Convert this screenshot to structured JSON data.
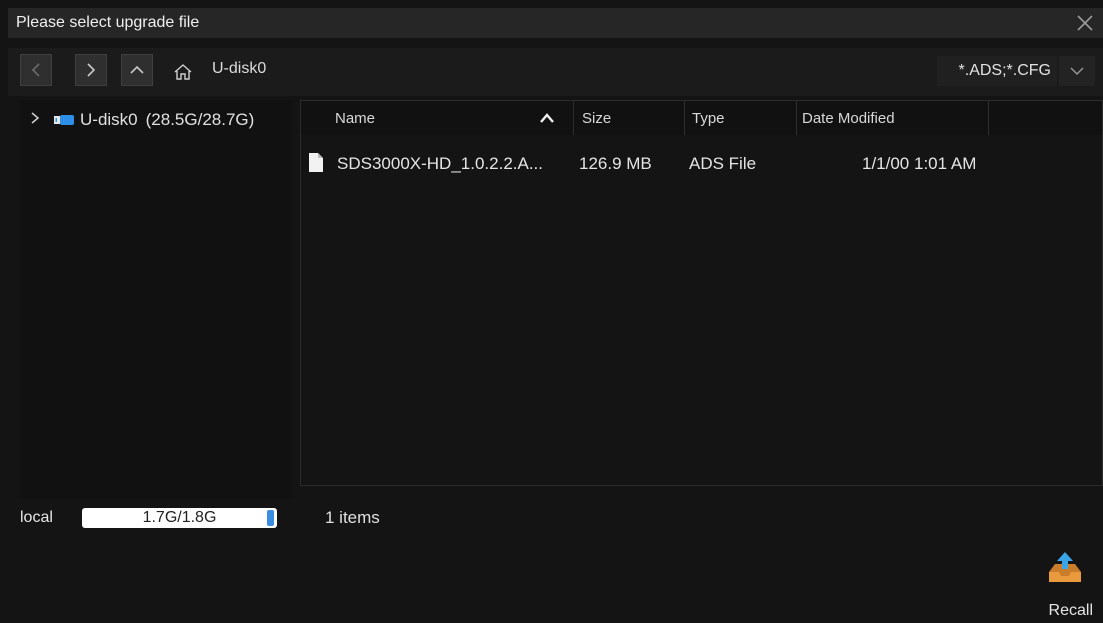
{
  "dialog": {
    "title": "Please select upgrade file"
  },
  "toolbar": {
    "path": "U-disk0",
    "filter": "*.ADS;*.CFG",
    "icons": [
      "back-icon",
      "forward-icon",
      "up-icon",
      "home-icon",
      "chevron-down-icon"
    ]
  },
  "tree": {
    "items": [
      {
        "label": "U-disk0",
        "capacity": "(28.5G/28.7G)",
        "icon": "usb-drive-icon"
      }
    ]
  },
  "list": {
    "headers": {
      "name": "Name",
      "size": "Size",
      "type": "Type",
      "modified": "Date Modified"
    },
    "sort": "name-ascending",
    "files": [
      {
        "name": "SDS3000X-HD_1.0.2.2.A...",
        "size": "126.9 MB",
        "type": "ADS File",
        "modified": "1/1/00 1:01 AM"
      }
    ],
    "count": "1 items"
  },
  "storage": {
    "label": "local",
    "value": "1.7G/1.8G",
    "used_fraction": 0.95
  },
  "actions": {
    "recall": "Recall"
  },
  "colors": {
    "accent": "#3a8de0",
    "background": "#141414",
    "titlebar": "#262626"
  }
}
